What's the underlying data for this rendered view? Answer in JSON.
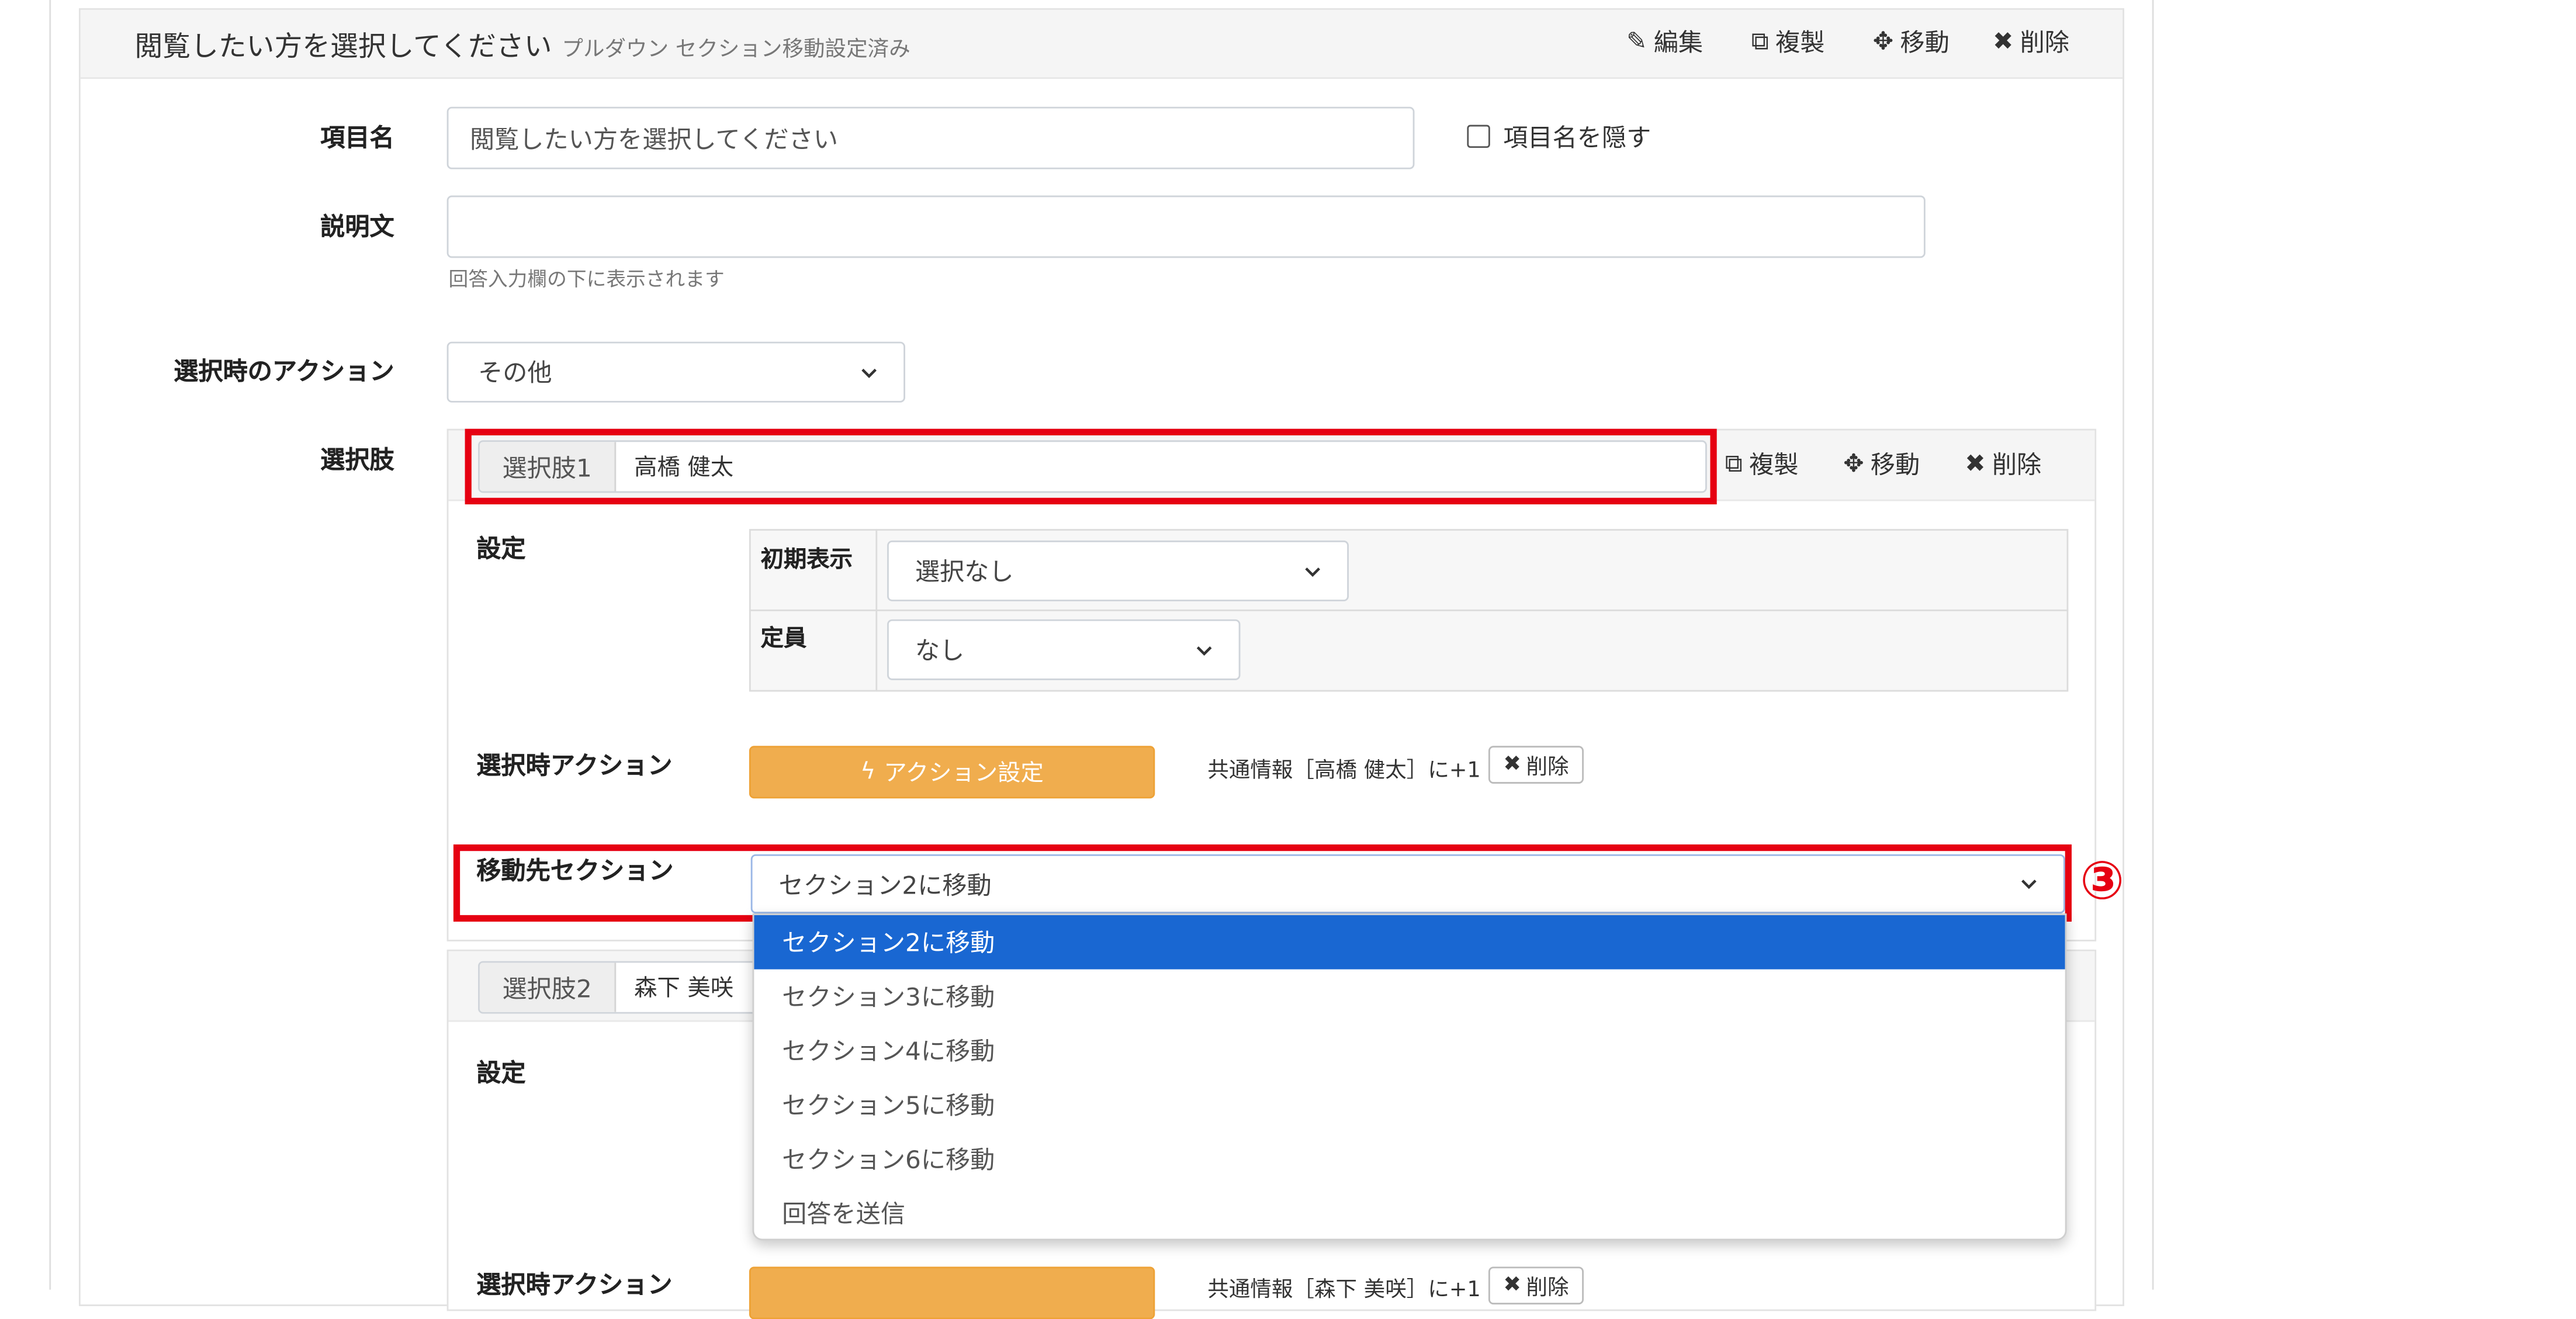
{
  "field_header": {
    "title": "閲覧したい方を選択してください",
    "subtitle": "プルダウン セクション移動設定済み",
    "actions": {
      "edit": "編集",
      "duplicate": "複製",
      "move": "移動",
      "delete": "削除"
    }
  },
  "form": {
    "item_name_label": "項目名",
    "item_name_value": "閲覧したい方を選択してください",
    "hide_label": "項目名を隠す",
    "description_label": "説明文",
    "description_value": "",
    "description_help": "回答入力欄の下に表示されます",
    "action_label": "選択時のアクション",
    "action_value": "その他",
    "choices_label": "選択肢"
  },
  "choice1": {
    "tag": "選択肢1",
    "value": "高橋 健太",
    "actions": {
      "duplicate": "複製",
      "move": "移動",
      "delete": "削除"
    },
    "settings_label": "設定",
    "initial_display_label": "初期表示",
    "initial_display_value": "選択なし",
    "capacity_label": "定員",
    "capacity_value": "なし",
    "select_action_label": "選択時アクション",
    "action_button_label": "アクション設定",
    "action_summary": "共通情報［高橋 健太］に+1",
    "action_delete_label": "削除",
    "destination_label": "移動先セクション",
    "destination_value": "セクション2に移動"
  },
  "choice2": {
    "tag": "選択肢2",
    "value": "森下 美咲",
    "settings_label": "設定",
    "select_action_label": "選択時アクション",
    "action_summary": "共通情報［森下 美咲］に+1",
    "action_delete_label": "削除"
  },
  "dropdown": {
    "options": [
      "セクション2に移動",
      "セクション3に移動",
      "セクション4に移動",
      "セクション5に移動",
      "セクション6に移動",
      "回答を送信"
    ],
    "selected_index": 0
  },
  "annotation": {
    "step_marker": "③"
  },
  "colors": {
    "accent_red": "#e60012",
    "action_orange": "#f0ad4e",
    "selected_blue": "#1967d2"
  }
}
